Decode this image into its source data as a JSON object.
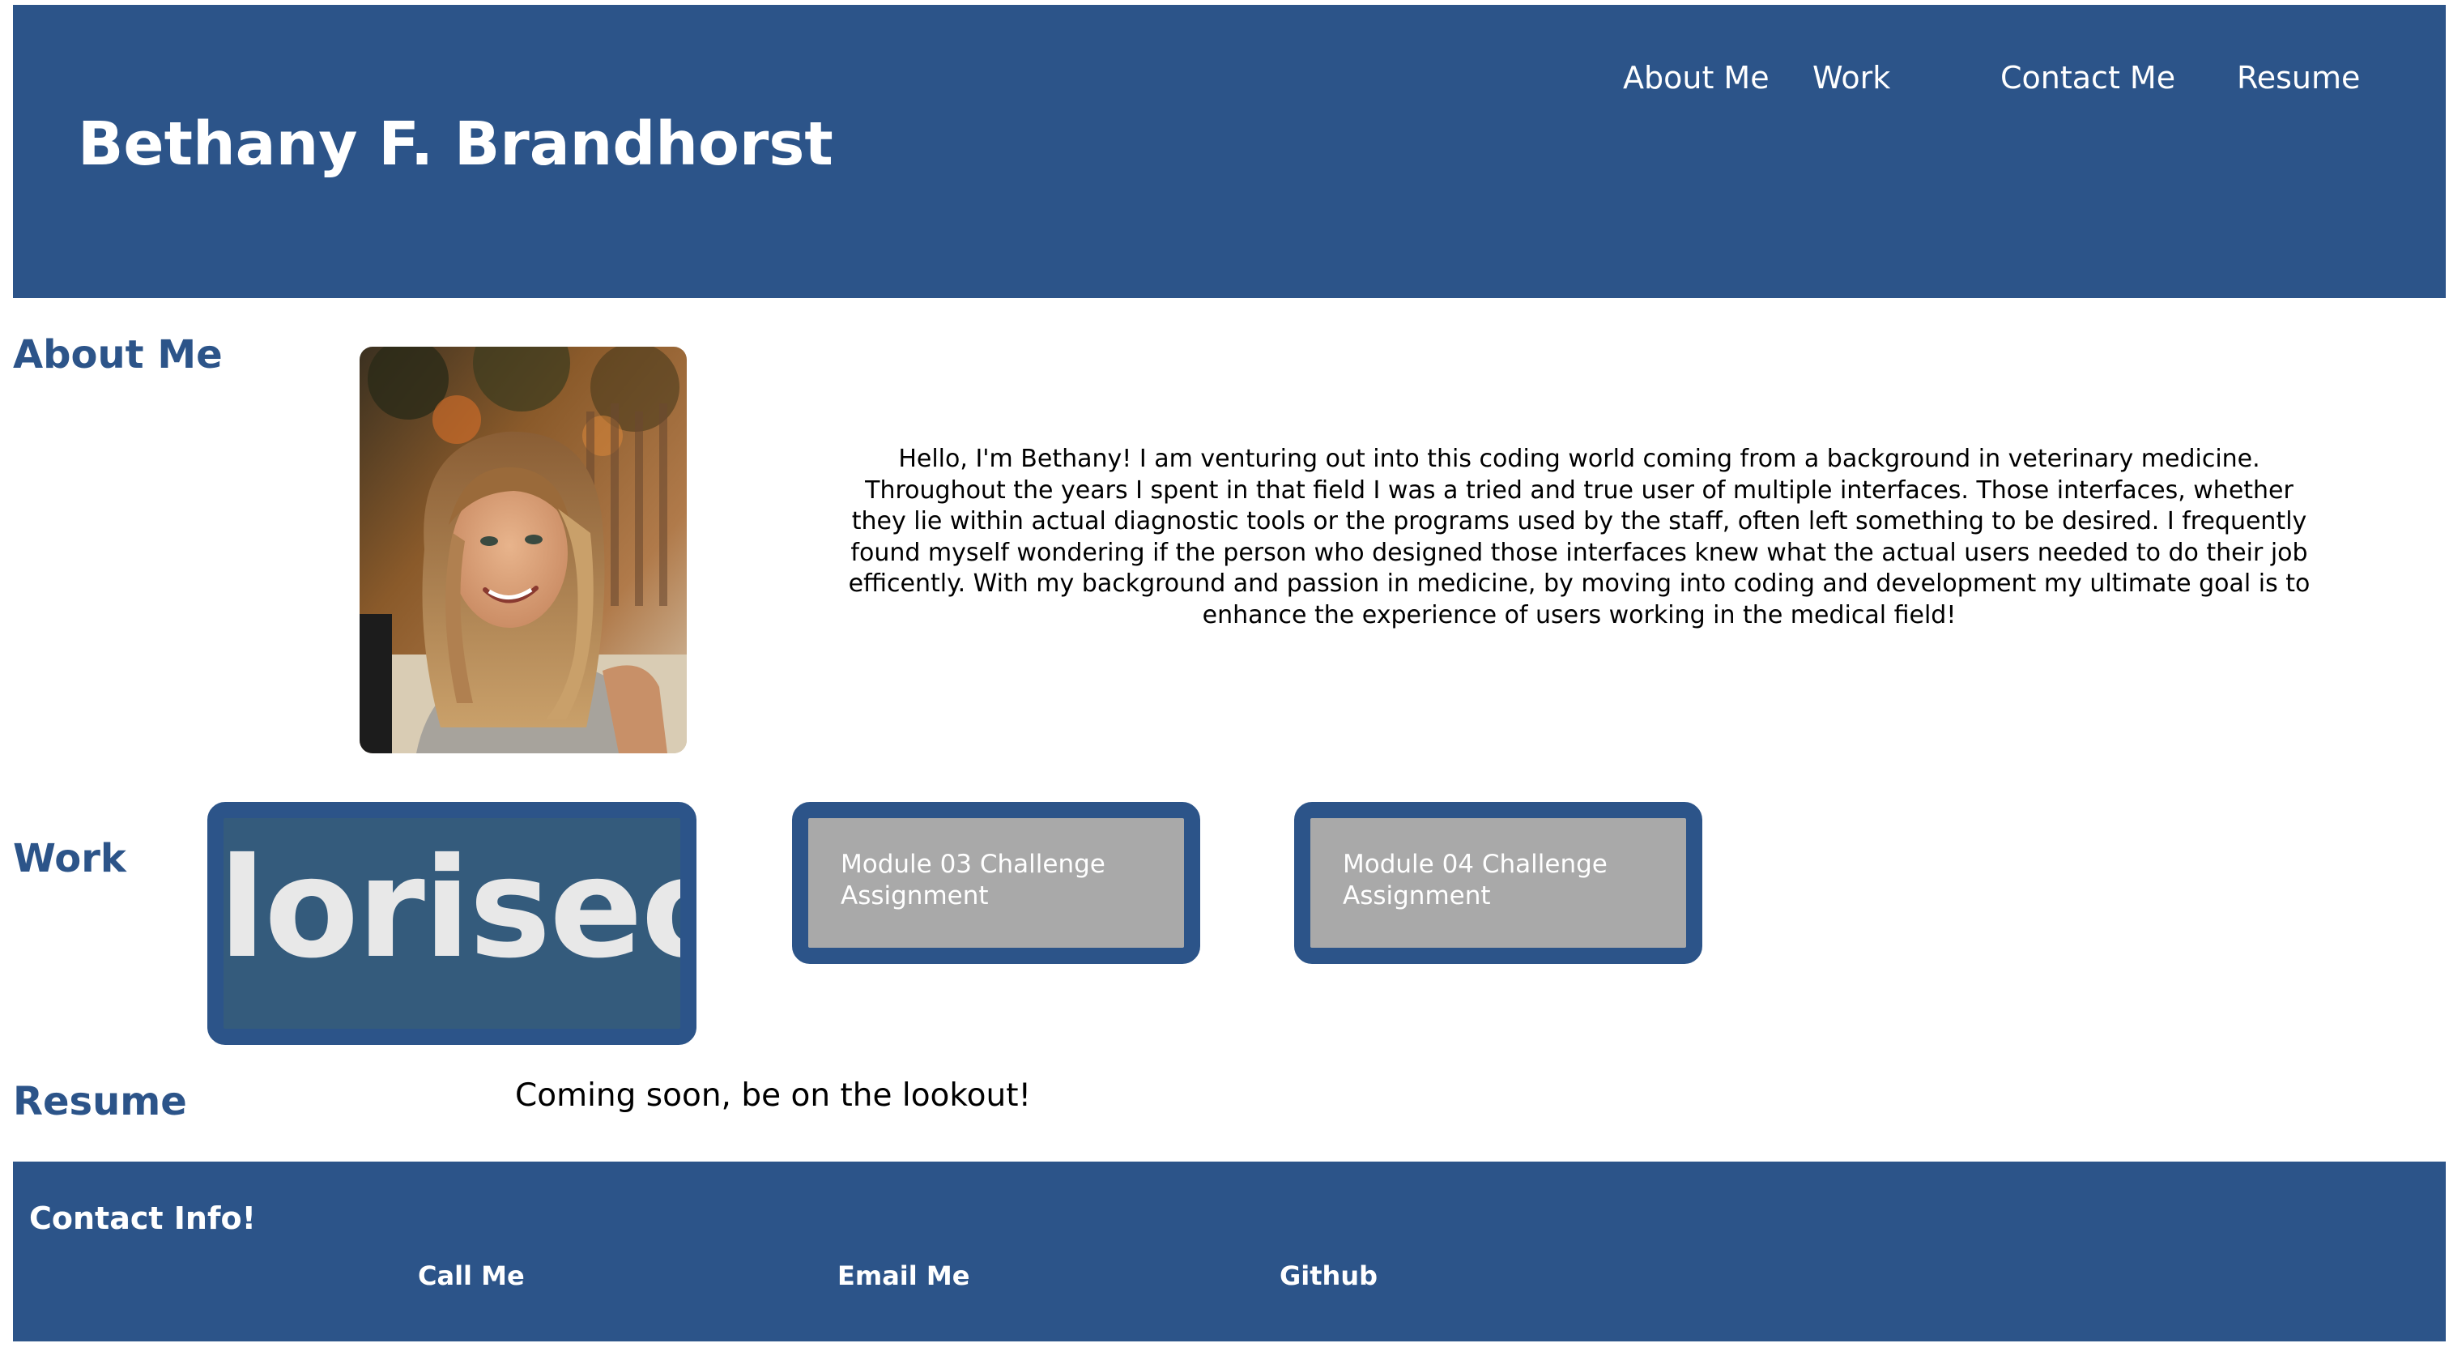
{
  "header": {
    "title": "Bethany F. Brandhorst",
    "nav": [
      "About Me",
      "Work",
      "Contact Me",
      "Resume"
    ]
  },
  "about": {
    "heading": "About Me",
    "photo_alt": "Portrait of Bethany",
    "text": "Hello, I'm Bethany! I am venturing out into this coding world coming from a background in veterinary medicine. Throughout the years I spent in that field I was a tried and true user of multiple interfaces. Those interfaces, whether they lie within actual diagnostic tools or the programs used by the staff, often left something to be desired. I frequently found myself wondering if the person who designed those interfaces knew what the actual users needed to do their job efficently. With my background and passion in medicine, by moving into coding and development my ultimate goal is to enhance the experience of users working in the medical field!"
  },
  "work": {
    "heading": "Work",
    "projects": [
      {
        "image_text": "loriseo"
      },
      {
        "label": "Module 03 Challenge Assignment"
      },
      {
        "label": "Module 04 Challenge Assignment"
      }
    ]
  },
  "resume": {
    "heading": "Resume",
    "text": "Coming soon, be on the lookout!"
  },
  "footer": {
    "heading": "Contact Info!",
    "links": [
      "Call Me",
      "Email Me",
      "Github"
    ]
  },
  "colors": {
    "brand": "#2c5489",
    "card_gray": "#a9a9a9",
    "card_image_bg": "#345b7c"
  }
}
